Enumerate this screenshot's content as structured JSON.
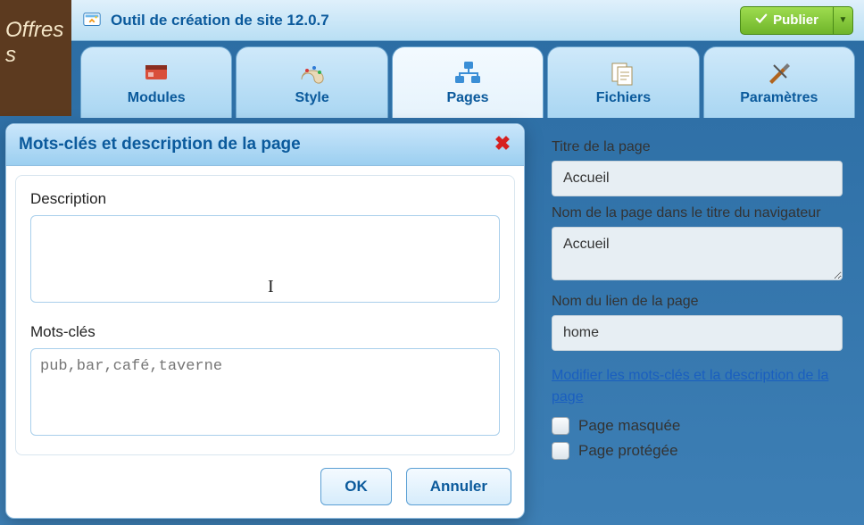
{
  "left_stripe": {
    "text": "Offres s"
  },
  "topbar": {
    "title": "Outil de création de site 12.0.7",
    "publish_label": "Publier"
  },
  "tabs": {
    "items": [
      {
        "label": "Modules"
      },
      {
        "label": "Style"
      },
      {
        "label": "Pages"
      },
      {
        "label": "Fichiers"
      },
      {
        "label": "Paramètres"
      }
    ],
    "active_index": 2
  },
  "panel": {
    "page_title_label": "Titre de la page",
    "page_title_value": "Accueil",
    "browser_name_label": "Nom de la page dans le titre du navigateur",
    "browser_name_value": "Accueil",
    "link_name_label": "Nom du lien de la page",
    "link_name_value": "home",
    "edit_meta_link": "Modifier les mots-clés et la description de la page",
    "hidden_label": "Page masquée",
    "protected_label": "Page protégée"
  },
  "modal": {
    "title": "Mots-clés et description de la page",
    "description_label": "Description",
    "description_value": "",
    "keywords_label": "Mots-clés",
    "keywords_placeholder": "pub,bar,café,taverne",
    "ok_label": "OK",
    "cancel_label": "Annuler"
  }
}
